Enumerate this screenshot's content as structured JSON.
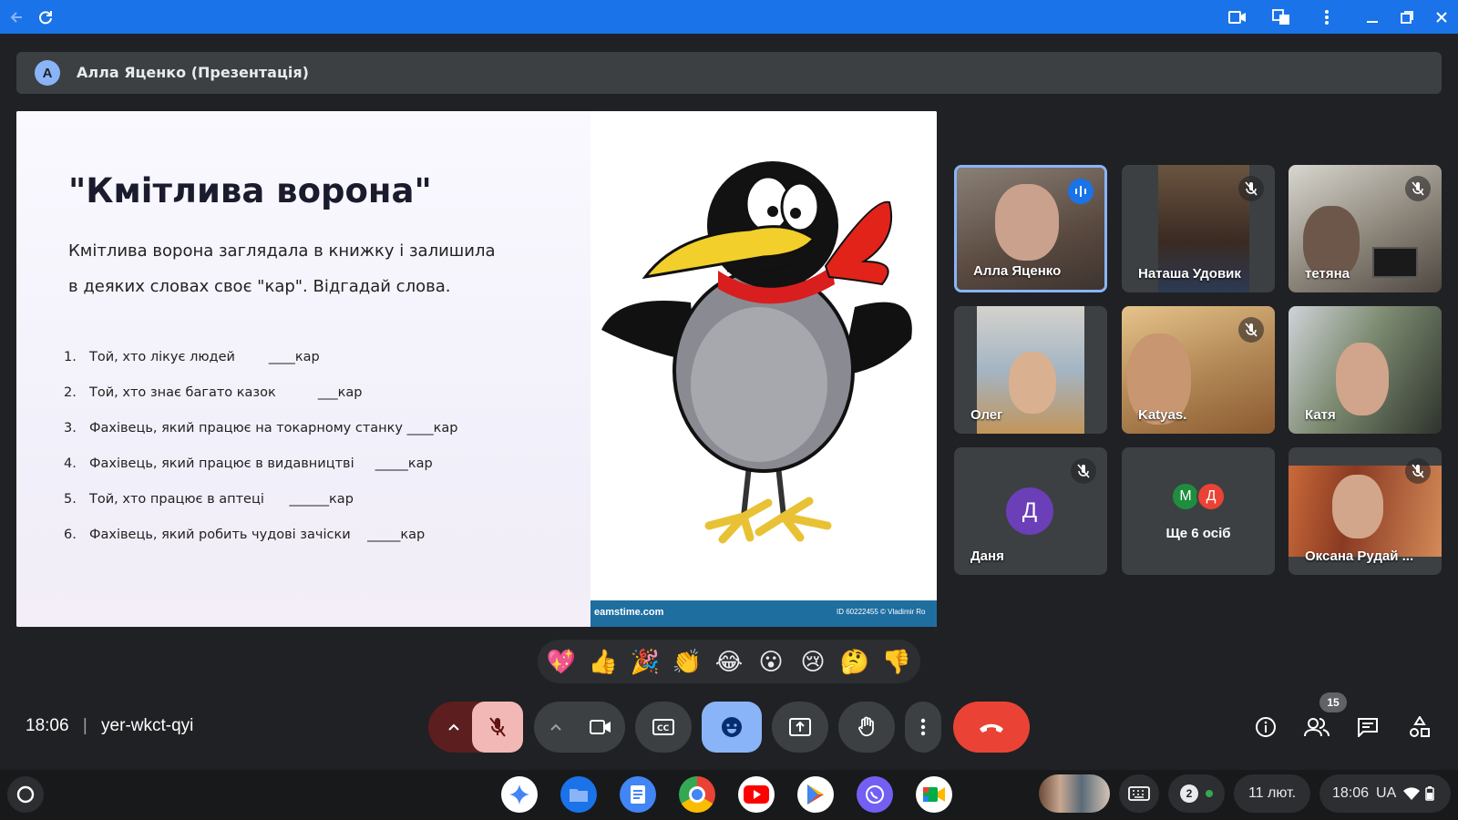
{
  "colors": {
    "browser_bar": "#1a73e8",
    "background": "#202124",
    "tile": "#3c4043",
    "end_call": "#ea4335",
    "reactions_active": "#8ab4f8",
    "mic_off": "#f2b8b5"
  },
  "browser": {
    "icons": [
      "back-arrow-icon",
      "refresh-icon",
      "camera-icon",
      "translate-icon",
      "more-vert-icon",
      "minimize-icon",
      "restore-icon",
      "close-icon"
    ]
  },
  "banner": {
    "avatar_letter": "A",
    "title": "Алла Яценко (Презентація)"
  },
  "slide": {
    "title": "\"Кмітлива ворона\"",
    "body": "Кмітлива ворона заглядала в книжку і залишила в деяких словах своє \"кар\". Відгадай слова.",
    "questions": [
      {
        "num": "1.",
        "text": "Той, хто лікує людей",
        "blank": "____кар"
      },
      {
        "num": "2.",
        "text": "Той, хто знає багато казок",
        "blank": "___кар"
      },
      {
        "num": "3.",
        "text": "Фахівець, який працює на токарному станку",
        "blank": "____кар"
      },
      {
        "num": "4.",
        "text": "Фахівець, який працює в видавництві",
        "blank": "_____кар"
      },
      {
        "num": "5.",
        "text": "Той, хто працює в аптеці",
        "blank": "______кар"
      },
      {
        "num": "6.",
        "text": "Фахівець, який робить чудові зачіски",
        "blank": "_____кар"
      }
    ],
    "image_watermark": "eamstime.com",
    "image_id": "ID 60222455 © Vladimir Ro"
  },
  "participants": [
    {
      "name": "Алла Яценко",
      "muted": false,
      "speaking": true,
      "color": "#6b5a4e"
    },
    {
      "name": "Наташа Удовик",
      "muted": true,
      "color": "#4a3a30"
    },
    {
      "name": "тетяна",
      "muted": true,
      "color": "#7a6a62"
    },
    {
      "name": "Олег",
      "muted": false,
      "color": "#8ea6b8"
    },
    {
      "name": "Katyas.",
      "muted": true,
      "color": "#b48a58"
    },
    {
      "name": "Катя",
      "muted": false,
      "color": "#5d6a58"
    },
    {
      "name": "Даня",
      "muted": true,
      "avatar": "Д"
    },
    {
      "more_label": "Ще 6 осіб",
      "avatars": [
        "М",
        "Д"
      ]
    },
    {
      "name": "Оксана Рудай ...",
      "muted": true,
      "color": "#a25a3a"
    }
  ],
  "reactions": [
    "💖",
    "👍",
    "🎉",
    "👏",
    "😂",
    "😮",
    "😢",
    "🤔",
    "👎"
  ],
  "meeting": {
    "time": "18:06",
    "separator": "|",
    "code": "yer-wkct-qyi",
    "participant_count": "15"
  },
  "controls": [
    "mic-options-icon",
    "mic-off-icon",
    "camera-options-icon",
    "camera-icon",
    "captions-icon",
    "emoji-icon",
    "present-icon",
    "raise-hand-icon",
    "more-vert-icon",
    "end-call-icon"
  ],
  "right_controls": [
    "info-icon",
    "people-icon",
    "chat-icon",
    "activities-icon"
  ],
  "taskbar": {
    "notifications": "2",
    "date": "11 лют.",
    "clock": "18:06",
    "region": "UA"
  }
}
